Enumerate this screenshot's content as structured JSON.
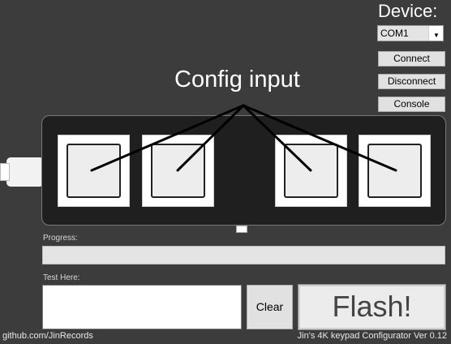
{
  "device": {
    "title": "Device:",
    "port_selected": "COM1",
    "dropdown_icon": "chevron-down-icon"
  },
  "buttons": {
    "connect": "Connect",
    "disconnect": "Disconnect",
    "console": "Console",
    "clear": "Clear",
    "flash": "Flash!"
  },
  "annotation": {
    "label": "Config input"
  },
  "keypad": {
    "keys": [
      {
        "id": 1
      },
      {
        "id": 2
      },
      {
        "id": 3
      },
      {
        "id": 4
      }
    ]
  },
  "progress": {
    "label": "Progress:",
    "value": 0
  },
  "test": {
    "label": "Test Here:",
    "value": ""
  },
  "footer": {
    "left": "github.com/JinRecords",
    "right": "Jin's 4K keypad Configurator Ver 0.12"
  }
}
